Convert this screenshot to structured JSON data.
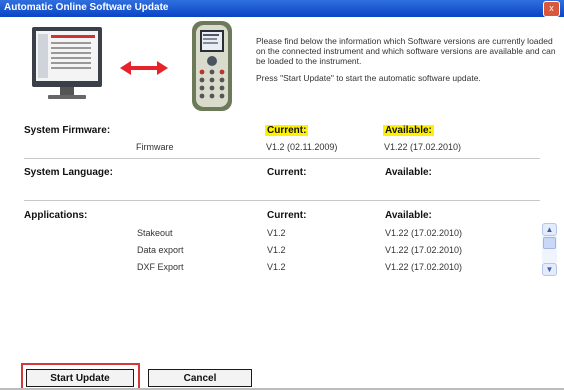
{
  "window": {
    "title": "Automatic Online Software Update",
    "close_glyph": "x"
  },
  "intro": {
    "line1": "Please find below the information which Software versions are currently loaded on the connected instrument and which software versions are available and can be loaded to the instrument.",
    "line2": "Press \"Start Update\" to start the automatic software update."
  },
  "firmware": {
    "section_label": "System Firmware:",
    "current_header": "Current:",
    "available_header": "Available:",
    "row": {
      "name": "Firmware",
      "current": "V1.2 (02.11.2009)",
      "available": "V1.22 (17.02.2010)"
    }
  },
  "language": {
    "section_label": "System Language:",
    "current_header": "Current:",
    "available_header": "Available:"
  },
  "applications": {
    "section_label": "Applications:",
    "current_header": "Current:",
    "available_header": "Available:",
    "rows": [
      {
        "name": "Stakeout",
        "current": "V1.2",
        "available": "V1.22 (17.02.2010)"
      },
      {
        "name": "Data export",
        "current": "V1.2",
        "available": "V1.22 (17.02.2010)"
      },
      {
        "name": "DXF Export",
        "current": "V1.2",
        "available": "V1.22 (17.02.2010)"
      }
    ]
  },
  "buttons": {
    "start": "Start Update",
    "cancel": "Cancel"
  },
  "colors": {
    "title_bar": "#0b44c4",
    "highlight": "#fff200",
    "focus_outline": "#d23a3a",
    "arrow": "#e8222a"
  }
}
